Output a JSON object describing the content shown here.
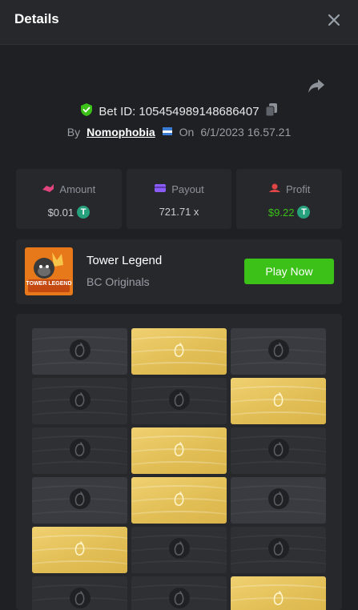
{
  "header": {
    "title": "Details"
  },
  "bet": {
    "id_label": "Bet ID: 105454989148686407",
    "by_label": "By",
    "username": "Nomophobia",
    "on_label": "On",
    "date": "6/1/2023 16.57.21"
  },
  "stats": {
    "amount": {
      "label": "Amount",
      "value": "$0.01"
    },
    "payout": {
      "label": "Payout",
      "value": "721.71 x"
    },
    "profit": {
      "label": "Profit",
      "value": "$9.22"
    }
  },
  "game": {
    "name": "Tower Legend",
    "provider": "BC Originals",
    "play_label": "Play Now",
    "thumb_text": "TOWER LEGEND"
  },
  "board": {
    "rows": [
      [
        "dim",
        "gold",
        "dim"
      ],
      [
        "dark",
        "dark",
        "gold"
      ],
      [
        "dark",
        "gold",
        "dark"
      ],
      [
        "dim",
        "gold",
        "dim"
      ],
      [
        "gold",
        "dark",
        "dark"
      ],
      [
        "dark",
        "dark",
        "gold"
      ]
    ]
  },
  "colors": {
    "accent_green": "#3bc117",
    "gold": "#e2bf56",
    "coin": "#27a17c"
  },
  "icons": {
    "close": "close-icon",
    "share": "share-icon",
    "shield": "shield-check-icon",
    "copy": "copy-icon",
    "amount": "amount-icon",
    "payout": "wallet-icon",
    "profit": "profit-icon",
    "coin": "tether-coin-icon",
    "gem": "mango-icon"
  }
}
